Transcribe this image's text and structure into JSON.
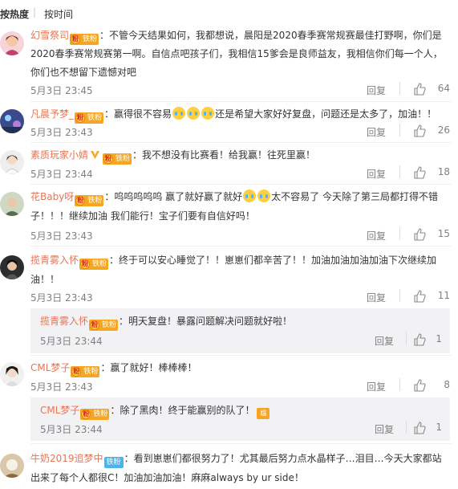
{
  "sort": {
    "hot": "按热度",
    "time": "按时间",
    "sep": "|"
  },
  "badge_fan": "铁粉",
  "comments": [
    {
      "user": "幻雪祭司",
      "sep": "：",
      "lines": [
        "不管今天结果如何，我都想说，晨阳是2020春季赛常规赛最佳打野啊，你们是",
        "2020春季赛常规赛第一啊。自信点吧孩子们，我相信15爹会是良师益友，我相信你们每一个人，",
        "你们也不想留下遗憾对吧"
      ],
      "time": "5月3日 23:45",
      "reply": "回复",
      "likes": "64"
    },
    {
      "user": "凡晨予梦_",
      "sep": "：",
      "text_a": "赢得很不容易",
      "text_b": "还是希望大家好好复盘，问题还是太多了，加油！！",
      "time": "5月3日 23:43",
      "reply": "回复",
      "likes": "26"
    },
    {
      "user": "素质玩家小婧",
      "sep": "：",
      "text": "我不想没有比赛看！给我赢！往死里赢！",
      "time": "5月3日 23:44",
      "reply": "回复",
      "likes": "18"
    },
    {
      "user": "花Baby呀",
      "sep": "：",
      "text_a": "呜呜呜呜呜 赢了就好赢了就好",
      "text_b": "太不容易了 今天除了第三局都打得不错",
      "line2": "子！！！继续加油 我们能行！宝子们要有自信好吗！",
      "time": "5月3日 23:43",
      "reply": "回复",
      "likes": "15"
    },
    {
      "user": "揽青雾入怀",
      "sep": "：",
      "text": "终于可以安心睡觉了！！崽崽们都辛苦了！！加油加油加油加油下次继续加",
      "line2": "油！！",
      "time": "5月3日 23:43",
      "reply": "回复",
      "likes": "11",
      "sub": {
        "user": "揽青雾入怀",
        "sep": "：",
        "text": "明天复盘！暴露问题解决问题就好啦！",
        "time": "5月3日 23:44",
        "reply": "回复",
        "likes": "1"
      }
    },
    {
      "user": "CML梦子",
      "sep": "：",
      "text": "赢了就好！棒棒棒！",
      "time": "5月3日 23:43",
      "reply": "回复",
      "likes": "8",
      "sub": {
        "user": "CML梦子",
        "sep": "：",
        "text": "除了黑肉！终于能赢别的队了！",
        "tag": "尴",
        "time": "5月3日 23:44",
        "reply": "回复",
        "likes": "1"
      }
    },
    {
      "user": "牛奶2019追梦中",
      "sep": "：",
      "text": "看到崽崽们都很努力了！尤其最后努力点水晶样子…泪目…今天大家都站",
      "line2": "出来了每个人都很C！加油加油加油！麻麻always by ur side！"
    }
  ],
  "colors": {
    "username": "#eb7350",
    "meta": "#808080",
    "sub_bg": "#f2f2f5"
  }
}
